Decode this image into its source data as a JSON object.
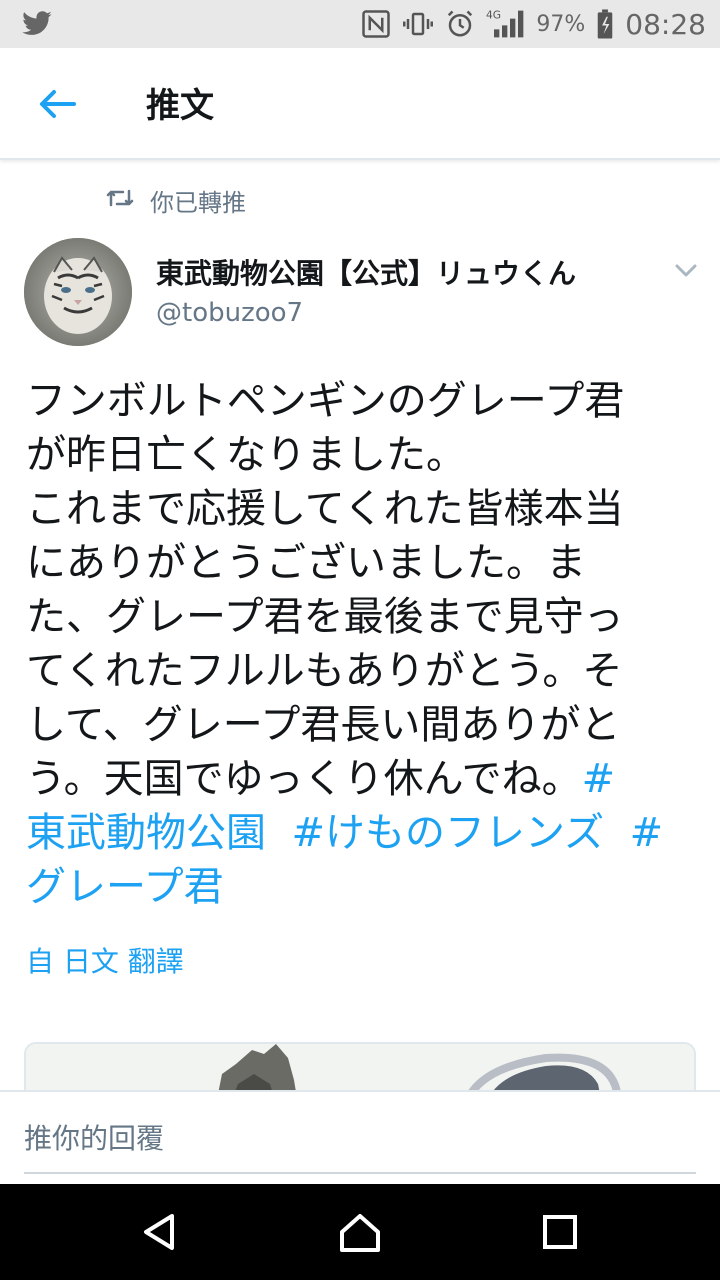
{
  "status_bar": {
    "battery_percent": "97%",
    "time": "08:28",
    "network": "4G",
    "icons": [
      "twitter-icon",
      "nfc-icon",
      "vibrate-icon",
      "alarm-icon",
      "signal-icon",
      "battery-icon"
    ]
  },
  "header": {
    "title": "推文",
    "back_icon": "arrow-left-icon"
  },
  "retweet": {
    "label": "你已轉推",
    "icon": "retweet-icon"
  },
  "author": {
    "name": "東武動物公園【公式】リュウくん",
    "handle": "@tobuzoo7"
  },
  "tweet": {
    "lines": [
      "フンボルトペンギンのグレープ君",
      "が昨日亡くなりました。",
      "これまで応援してくれた皆様本当",
      "にありがとうございました。ま",
      "た、グレープ君を最後まで見守っ",
      "てくれたフルルもありがとう。そ",
      "して、グレープ君長い間ありがと",
      "う。天国でゆっくり休んでね。"
    ],
    "hashtag_1_start": "#",
    "hashtag_1_end": "東武動物公園",
    "hashtag_2": "#けものフレンズ",
    "hashtag_3_start": "#",
    "hashtag_3_end": "グレープ君"
  },
  "translate_link": "自 日文 翻譯",
  "reply": {
    "placeholder": "推你的回覆"
  },
  "colors": {
    "accent": "#1da1f2",
    "secondary_text": "#657786",
    "primary_text": "#14171a",
    "divider": "#e1e8ed"
  }
}
